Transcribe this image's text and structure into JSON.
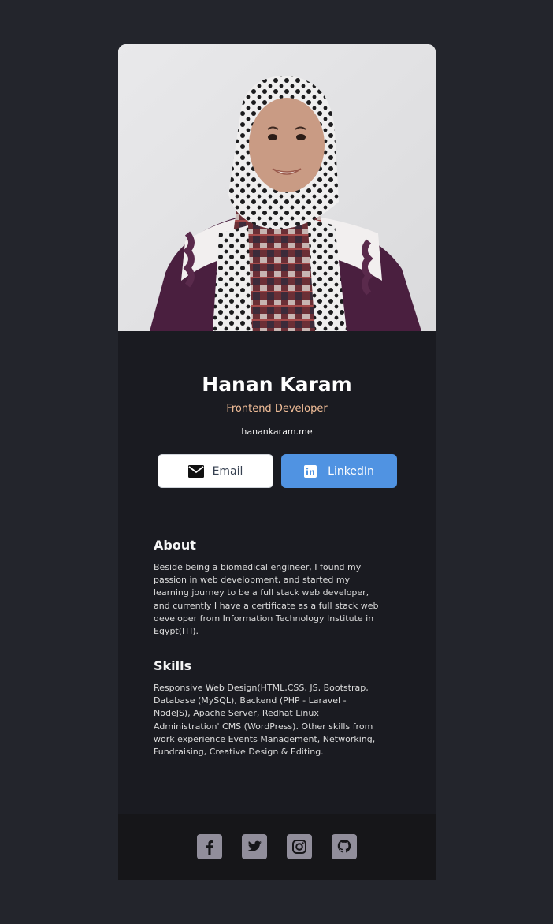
{
  "profile": {
    "photo_alt": "Hanan Karam",
    "name": "Hanan Karam",
    "title": "Frontend Developer",
    "website": "hanankaram.me"
  },
  "buttons": {
    "email": {
      "label": "Email",
      "icon": "envelope-icon"
    },
    "linkedin": {
      "label": "LinkedIn",
      "icon": "linkedin-icon"
    }
  },
  "about": {
    "heading": "About",
    "text": "Beside being a biomedical engineer, I found my passion in web development, and started my learning journey to be a full stack web developer, and currently I have a certificate as a full stack web developer from Information Technology Institute in Egypt(ITI)."
  },
  "skills": {
    "heading": "Skills",
    "text": "Responsive Web Design(HTML,CSS, JS, Bootstrap, Database (MySQL), Backend (PHP - Laravel -NodeJS), Apache Server, Redhat Linux Administration' CMS (WordPress). Other skills from work experience Events Management, Networking, Fundraising, Creative Design & Editing."
  },
  "footer": {
    "social": [
      "facebook-icon",
      "twitter-icon",
      "instagram-icon",
      "github-icon"
    ]
  },
  "colors": {
    "page_bg": "#23252C",
    "card_bg": "#1A1B21",
    "footer_bg": "#161619",
    "accent_title": "#F3BF99",
    "linkedin_blue": "#5093E2",
    "social_icon_bg": "#918E9B"
  }
}
